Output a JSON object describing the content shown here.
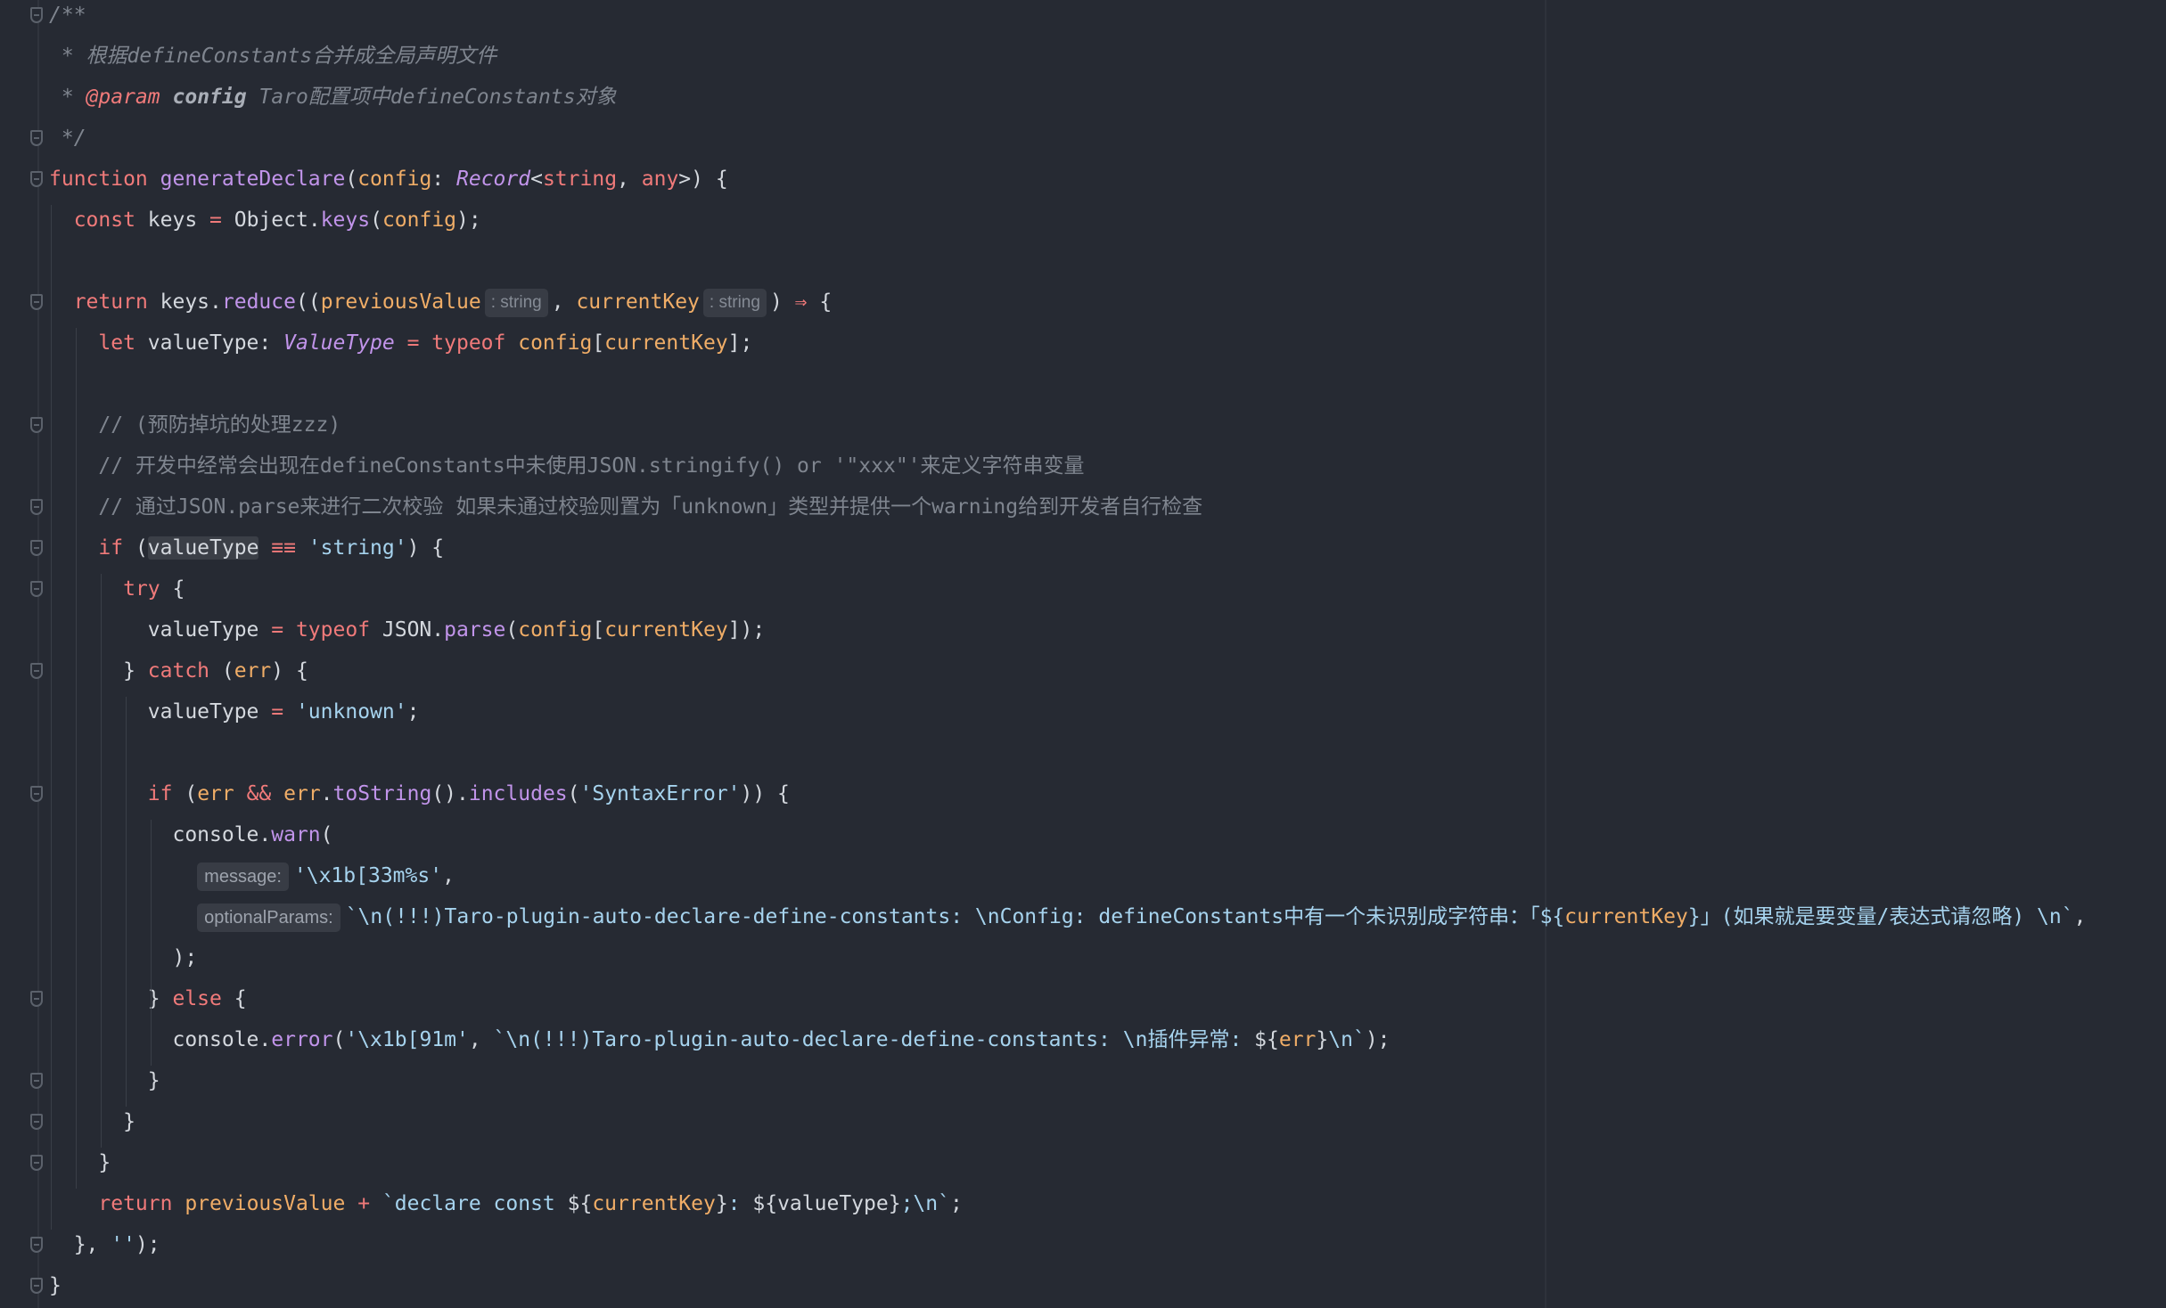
{
  "editor": {
    "lines": [
      [
        {
          "t": "/**",
          "c": "cmt-i"
        }
      ],
      [
        {
          "t": " * 根据defineConstants合并成全局声明文件",
          "c": "cmt-i"
        }
      ],
      [
        {
          "t": " * ",
          "c": "cmt-i"
        },
        {
          "t": "@param",
          "c": "tag"
        },
        {
          "t": " ",
          "c": "cmt-i"
        },
        {
          "t": "config",
          "c": "tagparam"
        },
        {
          "t": " Taro配置项中defineConstants对象",
          "c": "cmt-i"
        }
      ],
      [
        {
          "t": " */",
          "c": "cmt-i"
        }
      ],
      [
        {
          "t": "function ",
          "c": "kw"
        },
        {
          "t": "generateDeclare",
          "c": "fn"
        },
        {
          "t": "(",
          "c": "plain"
        },
        {
          "t": "config",
          "c": "param"
        },
        {
          "t": ": ",
          "c": "plain"
        },
        {
          "t": "Record",
          "c": "type"
        },
        {
          "t": "<",
          "c": "plain"
        },
        {
          "t": "string",
          "c": "prim"
        },
        {
          "t": ", ",
          "c": "plain"
        },
        {
          "t": "any",
          "c": "prim"
        },
        {
          "t": ">) {",
          "c": "plain"
        }
      ],
      [
        {
          "t": "  ",
          "c": "plain"
        },
        {
          "t": "const ",
          "c": "kw"
        },
        {
          "t": "keys ",
          "c": "plain"
        },
        {
          "t": "= ",
          "c": "op"
        },
        {
          "t": "Object.",
          "c": "plain"
        },
        {
          "t": "keys",
          "c": "fn"
        },
        {
          "t": "(",
          "c": "plain"
        },
        {
          "t": "config",
          "c": "param"
        },
        {
          "t": ");",
          "c": "plain"
        }
      ],
      [],
      [
        {
          "t": "  ",
          "c": "plain"
        },
        {
          "t": "return ",
          "c": "kw"
        },
        {
          "t": "keys.",
          "c": "plain"
        },
        {
          "t": "reduce",
          "c": "fn"
        },
        {
          "t": "((",
          "c": "plain"
        },
        {
          "t": "previousValue",
          "c": "param"
        },
        {
          "t": ": string",
          "c": "inlay small"
        },
        {
          "t": ", ",
          "c": "plain"
        },
        {
          "t": "currentKey",
          "c": "param"
        },
        {
          "t": ": string",
          "c": "inlay small"
        },
        {
          "t": ") ",
          "c": "plain"
        },
        {
          "t": "⇒",
          "c": "op"
        },
        {
          "t": " {",
          "c": "plain"
        }
      ],
      [
        {
          "t": "    ",
          "c": "plain"
        },
        {
          "t": "let ",
          "c": "kw"
        },
        {
          "t": "valueType",
          "c": "plain"
        },
        {
          "t": ": ",
          "c": "plain"
        },
        {
          "t": "ValueType",
          "c": "type"
        },
        {
          "t": " = ",
          "c": "op"
        },
        {
          "t": "typeof ",
          "c": "kw"
        },
        {
          "t": "config",
          "c": "param"
        },
        {
          "t": "[",
          "c": "plain"
        },
        {
          "t": "currentKey",
          "c": "param"
        },
        {
          "t": "];",
          "c": "plain"
        }
      ],
      [],
      [
        {
          "t": "    // (预防掉坑的处理zzz)",
          "c": "cmt"
        }
      ],
      [
        {
          "t": "    // 开发中经常会出现在defineConstants中未使用JSON.stringify() or '\"xxx\"'来定义字符串变量",
          "c": "cmt"
        }
      ],
      [
        {
          "t": "    // 通过JSON.parse来进行二次校验 如果未通过校验则置为「unknown」类型并提供一个warning给到开发者自行检查",
          "c": "cmt"
        }
      ],
      [
        {
          "t": "    ",
          "c": "plain"
        },
        {
          "t": "if ",
          "c": "kw"
        },
        {
          "t": "(",
          "c": "plain"
        },
        {
          "t": "valueType",
          "c": "plain hl"
        },
        {
          "t": " ≡≡ ",
          "c": "op"
        },
        {
          "t": "'string'",
          "c": "str"
        },
        {
          "t": ") {",
          "c": "plain"
        }
      ],
      [
        {
          "t": "      ",
          "c": "plain"
        },
        {
          "t": "try ",
          "c": "kw"
        },
        {
          "t": "{",
          "c": "plain"
        }
      ],
      [
        {
          "t": "        valueType ",
          "c": "plain"
        },
        {
          "t": "= ",
          "c": "op"
        },
        {
          "t": "typeof ",
          "c": "kw"
        },
        {
          "t": "JSON.",
          "c": "plain"
        },
        {
          "t": "parse",
          "c": "fn"
        },
        {
          "t": "(",
          "c": "plain"
        },
        {
          "t": "config",
          "c": "param"
        },
        {
          "t": "[",
          "c": "plain"
        },
        {
          "t": "currentKey",
          "c": "param"
        },
        {
          "t": "]);",
          "c": "plain"
        }
      ],
      [
        {
          "t": "      } ",
          "c": "plain"
        },
        {
          "t": "catch ",
          "c": "kw"
        },
        {
          "t": "(",
          "c": "plain"
        },
        {
          "t": "err",
          "c": "param"
        },
        {
          "t": ") {",
          "c": "plain"
        }
      ],
      [
        {
          "t": "        valueType ",
          "c": "plain"
        },
        {
          "t": "= ",
          "c": "op"
        },
        {
          "t": "'unknown'",
          "c": "str"
        },
        {
          "t": ";",
          "c": "plain"
        }
      ],
      [],
      [
        {
          "t": "        ",
          "c": "plain"
        },
        {
          "t": "if ",
          "c": "kw"
        },
        {
          "t": "(",
          "c": "plain"
        },
        {
          "t": "err ",
          "c": "param"
        },
        {
          "t": "&& ",
          "c": "op"
        },
        {
          "t": "err",
          "c": "param"
        },
        {
          "t": ".",
          "c": "plain"
        },
        {
          "t": "toString",
          "c": "fn"
        },
        {
          "t": "().",
          "c": "plain"
        },
        {
          "t": "includes",
          "c": "fn"
        },
        {
          "t": "(",
          "c": "plain"
        },
        {
          "t": "'SyntaxError'",
          "c": "str"
        },
        {
          "t": ")) {",
          "c": "plain"
        }
      ],
      [
        {
          "t": "          console.",
          "c": "plain"
        },
        {
          "t": "warn",
          "c": "fn"
        },
        {
          "t": "(",
          "c": "plain"
        }
      ],
      [
        {
          "t": "            ",
          "c": "plain"
        },
        {
          "t": "message:",
          "c": "inlay"
        },
        {
          "t": "'\\x1b[33m%s'",
          "c": "str"
        },
        {
          "t": ",",
          "c": "plain"
        }
      ],
      [
        {
          "t": "            ",
          "c": "plain"
        },
        {
          "t": "optionalParams:",
          "c": "inlay"
        },
        {
          "t": "`\\n(!!!)Taro-plugin-auto-declare-define-constants: \\nConfig: defineConstants中有一个未识别成字符串：「${",
          "c": "str"
        },
        {
          "t": "currentKey",
          "c": "param"
        },
        {
          "t": "}」(如果就是要变量/表达式请忽略) \\n`",
          "c": "str"
        },
        {
          "t": ",",
          "c": "plain"
        }
      ],
      [
        {
          "t": "          );",
          "c": "plain"
        }
      ],
      [
        {
          "t": "        } ",
          "c": "plain"
        },
        {
          "t": "else ",
          "c": "kw"
        },
        {
          "t": "{",
          "c": "plain"
        }
      ],
      [
        {
          "t": "          console.",
          "c": "plain"
        },
        {
          "t": "error",
          "c": "fn"
        },
        {
          "t": "(",
          "c": "plain"
        },
        {
          "t": "'\\x1b[91m'",
          "c": "str"
        },
        {
          "t": ", ",
          "c": "plain"
        },
        {
          "t": "`\\n(!!!)Taro-plugin-auto-declare-define-constants: \\n插件异常: ",
          "c": "str"
        },
        {
          "t": "${",
          "c": "plain"
        },
        {
          "t": "err",
          "c": "param"
        },
        {
          "t": "}",
          "c": "plain"
        },
        {
          "t": "\\n`",
          "c": "str"
        },
        {
          "t": ");",
          "c": "plain"
        }
      ],
      [
        {
          "t": "        }",
          "c": "plain"
        }
      ],
      [
        {
          "t": "      }",
          "c": "plain"
        }
      ],
      [
        {
          "t": "    }",
          "c": "plain"
        }
      ],
      [
        {
          "t": "    ",
          "c": "plain"
        },
        {
          "t": "return ",
          "c": "kw"
        },
        {
          "t": "previousValue ",
          "c": "param"
        },
        {
          "t": "+ ",
          "c": "op"
        },
        {
          "t": "`declare const ",
          "c": "str"
        },
        {
          "t": "${",
          "c": "plain"
        },
        {
          "t": "currentKey",
          "c": "param"
        },
        {
          "t": "}",
          "c": "plain"
        },
        {
          "t": ": ",
          "c": "str"
        },
        {
          "t": "${",
          "c": "plain"
        },
        {
          "t": "valueType",
          "c": "plain"
        },
        {
          "t": "}",
          "c": "plain"
        },
        {
          "t": ";\\n`",
          "c": "str"
        },
        {
          "t": ";",
          "c": "plain"
        }
      ],
      [
        {
          "t": "  }, ",
          "c": "plain"
        },
        {
          "t": "''",
          "c": "str"
        },
        {
          "t": ");",
          "c": "plain"
        }
      ],
      [
        {
          "t": "}",
          "c": "plain"
        }
      ]
    ]
  }
}
